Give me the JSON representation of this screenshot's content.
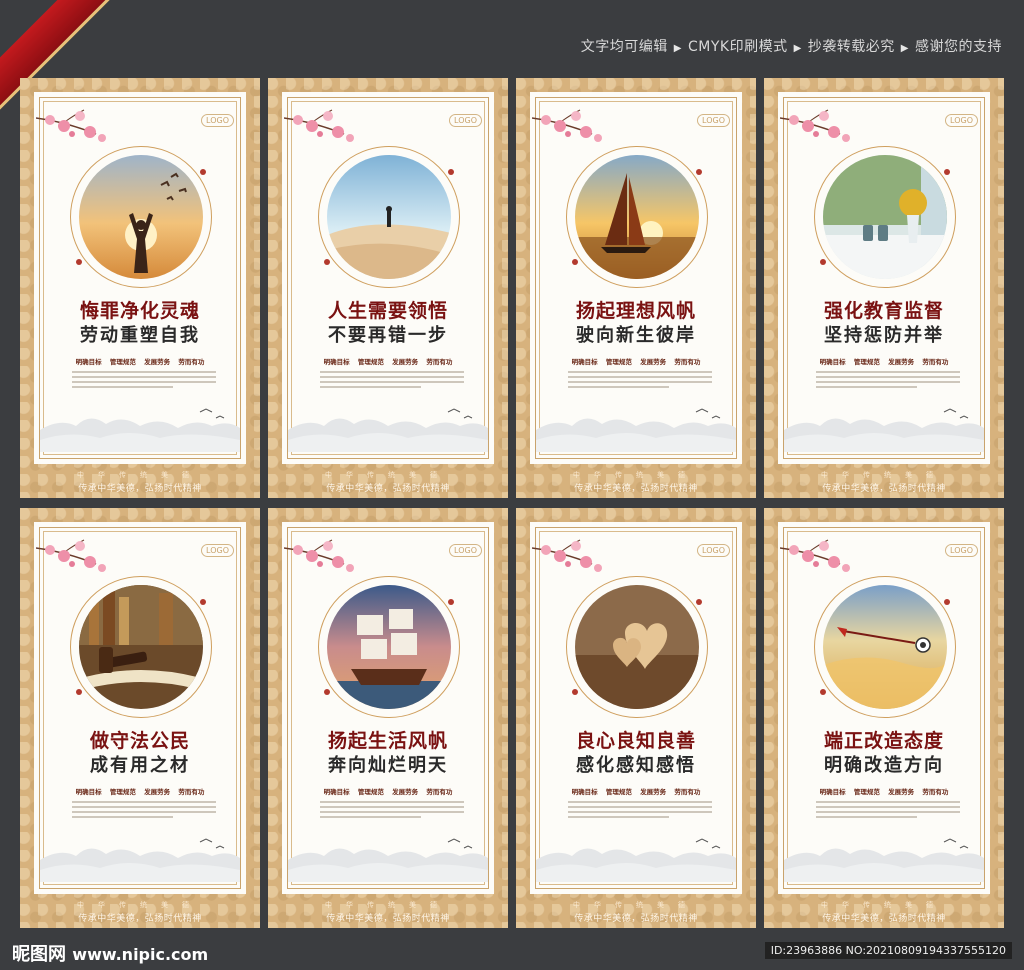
{
  "header": {
    "items": [
      "文字均可编辑",
      "CMYK印刷模式",
      "抄袭转载必究",
      "感谢您的支持"
    ],
    "separator": "▶"
  },
  "common": {
    "logo": "LOGO",
    "tags": [
      "明确目标",
      "管理规范",
      "发展劳务",
      "劳而有功"
    ],
    "char_row": "中华传统美德",
    "slogan": "传承中华美德，弘扬时代精神"
  },
  "posters": [
    {
      "title1": "悔罪净化灵魂",
      "title2": "劳动重塑自我",
      "image": "person-sunset"
    },
    {
      "title1": "人生需要领悟",
      "title2": "不要再错一步",
      "image": "desert-walker"
    },
    {
      "title1": "扬起理想风帆",
      "title2": "驶向新生彼岸",
      "image": "sailboat-sunset"
    },
    {
      "title1": "强化教育监督",
      "title2": "坚持惩防并举",
      "image": "window-flowers"
    },
    {
      "title1": "做守法公民",
      "title2": "成有用之材",
      "image": "gavel-book"
    },
    {
      "title1": "扬起生活风帆",
      "title2": "奔向灿烂明天",
      "image": "tall-ship"
    },
    {
      "title1": "良心良知良善",
      "title2": "感化感知感悟",
      "image": "heart-cookies"
    },
    {
      "title1": "端正改造态度",
      "title2": "明确改造方向",
      "image": "arrow-target"
    }
  ],
  "footer": {
    "brand": "昵图网",
    "site": "www.nipic.com",
    "id": "ID:23963886 NO:20210809194337555120"
  }
}
